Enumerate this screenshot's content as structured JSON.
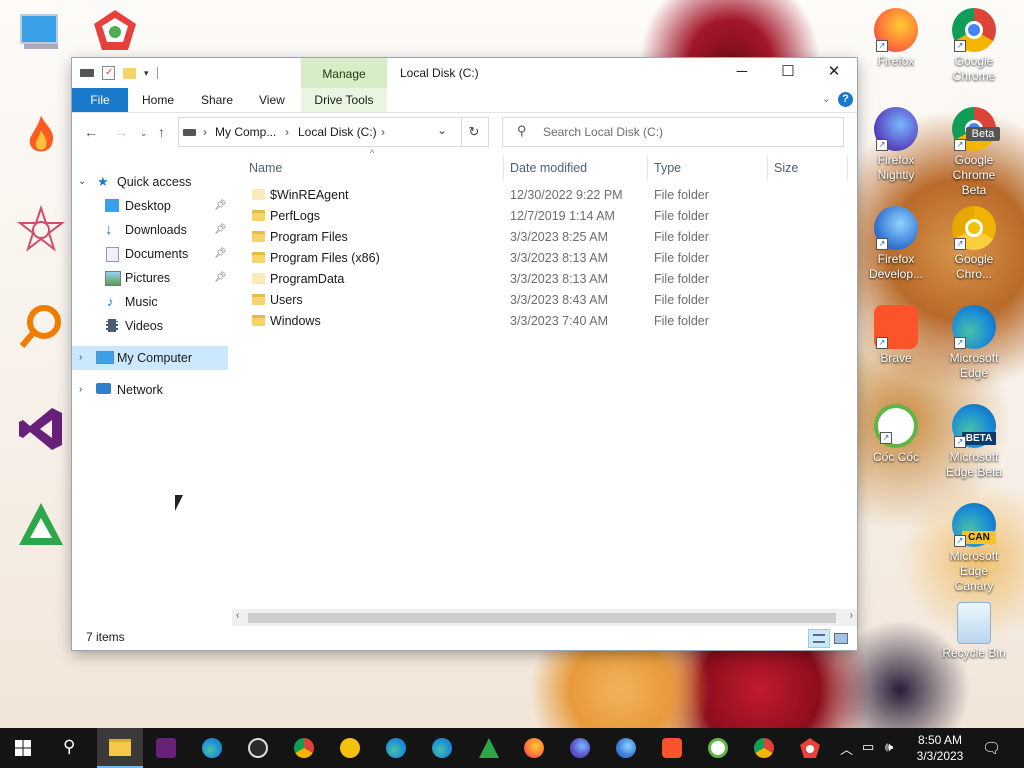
{
  "window": {
    "title": "Local Disk (C:)",
    "manage_label": "Manage",
    "ribbon_tabs": [
      "File",
      "Home",
      "Share",
      "View",
      "Drive Tools"
    ],
    "breadcrumb": [
      "My Comp...",
      "Local Disk (C:)"
    ],
    "search_placeholder": "Search Local Disk (C:)",
    "help": "?"
  },
  "nav": {
    "quick_access": "Quick access",
    "items": [
      "Desktop",
      "Downloads",
      "Documents",
      "Pictures",
      "Music",
      "Videos"
    ],
    "my_computer": "My Computer",
    "network": "Network"
  },
  "columns": {
    "name": "Name",
    "date": "Date modified",
    "type": "Type",
    "size": "Size"
  },
  "files": [
    {
      "name": "$WinREAgent",
      "date": "12/30/2022 9:22 PM",
      "type": "File folder"
    },
    {
      "name": "PerfLogs",
      "date": "12/7/2019 1:14 AM",
      "type": "File folder"
    },
    {
      "name": "Program Files",
      "date": "3/3/2023 8:25 AM",
      "type": "File folder"
    },
    {
      "name": "Program Files (x86)",
      "date": "3/3/2023 8:13 AM",
      "type": "File folder"
    },
    {
      "name": "ProgramData",
      "date": "3/3/2023 8:13 AM",
      "type": "File folder"
    },
    {
      "name": "Users",
      "date": "3/3/2023 8:43 AM",
      "type": "File folder"
    },
    {
      "name": "Windows",
      "date": "3/3/2023 7:40 AM",
      "type": "File folder"
    }
  ],
  "status": "7 items",
  "desktop_icons": [
    {
      "label": "Firefox",
      "color": "#ff7139"
    },
    {
      "label": "Google Chrome",
      "color": "#2b7de9"
    },
    {
      "label": "Firefox Nightly",
      "color": "#5b4fc7"
    },
    {
      "label": "Google Chrome Beta",
      "color": "#2b7de9"
    },
    {
      "label": "Firefox Develop...",
      "color": "#3a7bd5"
    },
    {
      "label": "Google Chro...",
      "color": "#f4c20d"
    },
    {
      "label": "Brave",
      "color": "#fb542b"
    },
    {
      "label": "Microsoft Edge",
      "color": "#1a8cd8"
    },
    {
      "label": "Cốc Cốc",
      "color": "#5fb548"
    },
    {
      "label": "Microsoft Edge Beta",
      "color": "#1a8cd8"
    },
    {
      "label": "Microsoft Edge Canary",
      "color": "#1a8cd8"
    },
    {
      "label": "Recycle Bin",
      "color": "#cfe3f5"
    }
  ],
  "badges": {
    "beta": "Beta",
    "edge_beta": "BETA",
    "canary": "CAN"
  },
  "clock": {
    "time": "8:50 AM",
    "date": "3/3/2023"
  }
}
